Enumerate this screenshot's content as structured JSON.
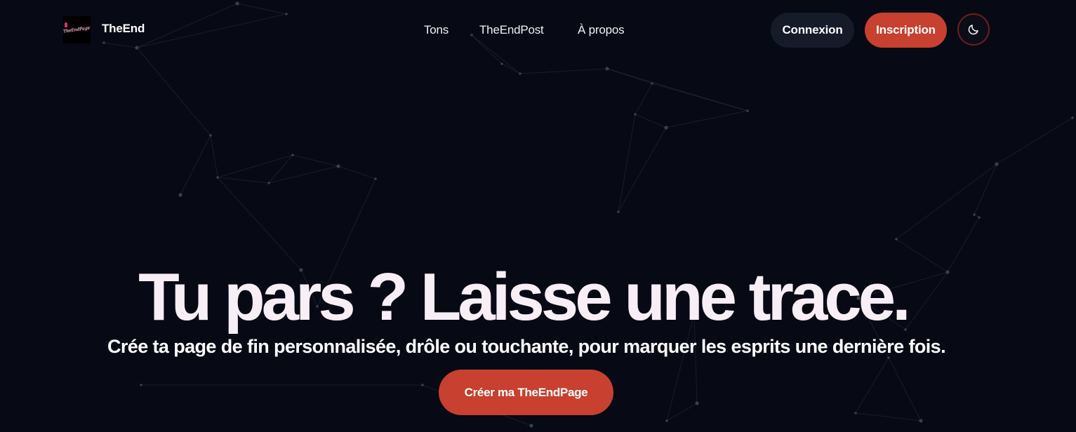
{
  "header": {
    "logo_text": "TheEndPage",
    "brand": "TheEnd",
    "nav": {
      "tons": "Tons",
      "post": "TheEndPost",
      "about": "À propos"
    },
    "login_label": "Connexion",
    "signup_label": "Inscription",
    "theme_icon": "moon-icon"
  },
  "hero": {
    "title": "Tu pars ? Laisse une trace.",
    "subtitle": "Crée ta page de fin personnalisée, drôle ou touchante, pour marquer les esprits une dernière fois.",
    "cta_label": "Créer ma TheEndPage"
  },
  "colors": {
    "background": "#070914",
    "accent": "#c8402f",
    "secondary_button": "#161b29",
    "title": "#f8eef6"
  }
}
